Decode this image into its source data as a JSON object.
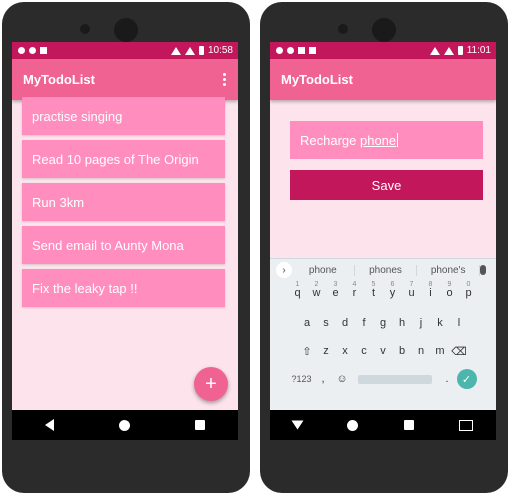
{
  "left_phone": {
    "status": {
      "time": "10:58"
    },
    "appbar": {
      "title": "MyTodoList"
    },
    "todos": [
      "practise singing",
      "Read 10 pages of The Origin",
      "Run 3km",
      "Send email to Aunty Mona",
      "Fix the leaky tap !!"
    ],
    "fab": {
      "label": "+"
    }
  },
  "right_phone": {
    "status": {
      "time": "11:01"
    },
    "appbar": {
      "title": "MyTodoList"
    },
    "input": {
      "value_prefix": "Recharge ",
      "value_word": "phone"
    },
    "save_label": "Save",
    "keyboard": {
      "suggestions": [
        "phone",
        "phones",
        "phone's"
      ],
      "row1": [
        "q",
        "w",
        "e",
        "r",
        "t",
        "y",
        "u",
        "i",
        "o",
        "p"
      ],
      "row1_hints": [
        "1",
        "2",
        "3",
        "4",
        "5",
        "6",
        "7",
        "8",
        "9",
        "0"
      ],
      "row2": [
        "a",
        "s",
        "d",
        "f",
        "g",
        "h",
        "j",
        "k",
        "l"
      ],
      "row3": [
        "z",
        "x",
        "c",
        "v",
        "b",
        "n",
        "m"
      ],
      "symbols_label": "?123",
      "comma": ",",
      "period": "."
    }
  },
  "colors": {
    "statusbar": "#c2185b",
    "appbar": "#f06292",
    "item": "#ff8ebf",
    "save": "#c2185b",
    "screen_bg": "#fde4ec"
  }
}
